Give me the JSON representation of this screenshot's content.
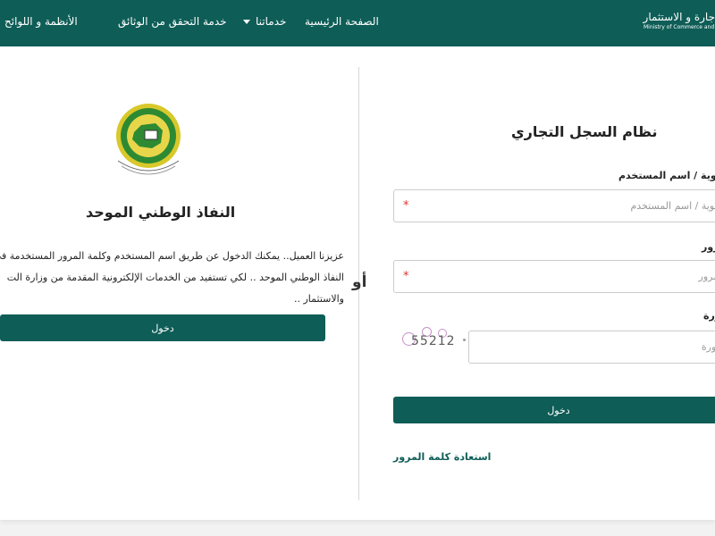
{
  "header": {
    "logo_ar": "جارة و الاستثمار",
    "logo_en": "Ministry of Commerce and Investment",
    "nav": [
      {
        "label": "الصفحة الرئيسية"
      },
      {
        "label": "خدماتنا"
      },
      {
        "label": "خدمة التحقق من الوثائق"
      },
      {
        "label": "الأنظمة و اللوائح"
      }
    ]
  },
  "or_label": "أو",
  "right_panel": {
    "title": "نظام السجل التجاري",
    "username_label": "هوية / اسم المستخدم",
    "username_placeholder": "الهوية / اسم المستخدم",
    "password_label": "رور",
    "password_placeholder": "المرور",
    "captcha_label": "صورة",
    "captcha_placeholder": "صورة",
    "captcha_code": "55212",
    "required_mark": "*",
    "login_label": "دخول",
    "forgot_password": "استعادة كلمة المرور"
  },
  "left_panel": {
    "title": "النفاذ الوطني الموحد",
    "desc_line1": "عزيزنا العميل.. يمكنك الدخول عن طريق اسم المستخدم وكلمة المرور المستخدمة في",
    "desc_line2": "النفاذ الوطني الموحد .. لكي تستفيد من الخدمات الإلكترونية المقدمة من وزارة الت",
    "desc_line3": "والاستثمار ..",
    "login_label": "دخول",
    "emblem_text": "النفاذ الوطني الموحد"
  },
  "colors": {
    "brand": "#0e5d57",
    "required": "#dd3333",
    "captcha_ring": "#c890c8"
  }
}
